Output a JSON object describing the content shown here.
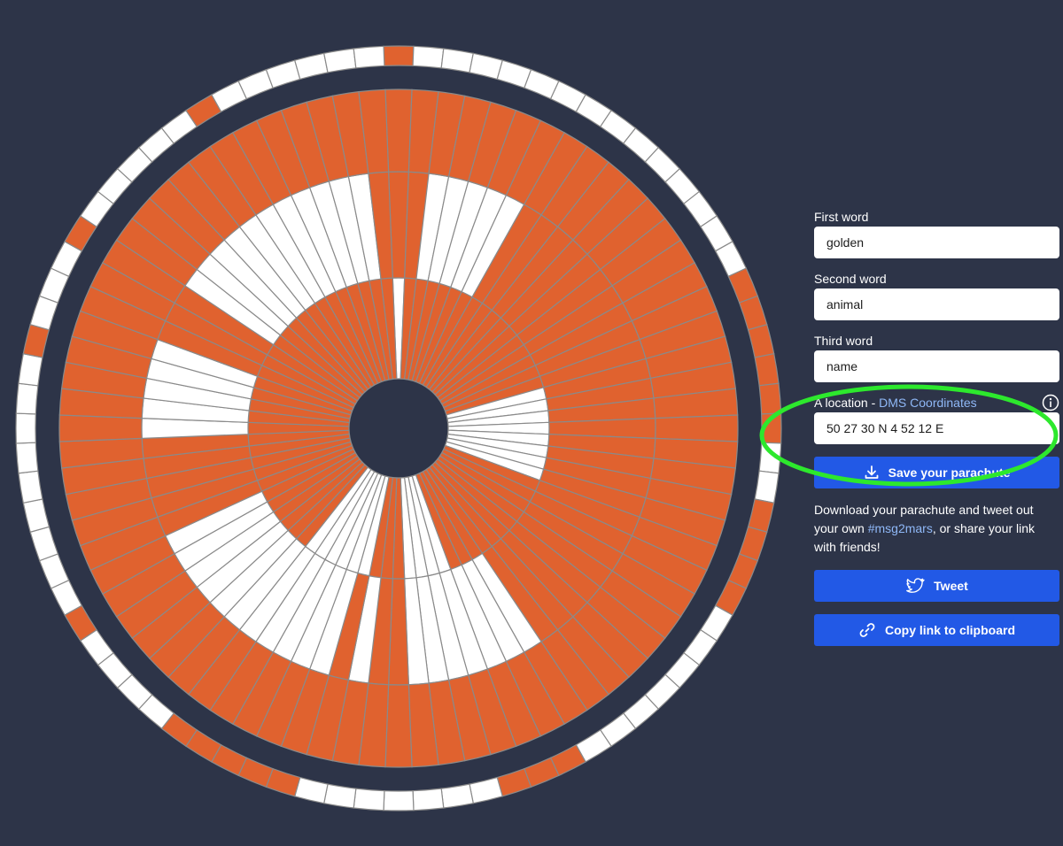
{
  "colors": {
    "background": "#2d3448",
    "orange": "#e0622f",
    "white": "#ffffff",
    "grid": "#8a8a8a",
    "button": "#2259e6",
    "link": "#8fb8f7",
    "highlight": "#2de82d"
  },
  "form": {
    "first_word": {
      "label": "First word",
      "value": "golden"
    },
    "second_word": {
      "label": "Second word",
      "value": "animal"
    },
    "third_word": {
      "label": "Third word",
      "value": "name"
    },
    "location": {
      "label": "A location - ",
      "link_label": "DMS Coordinates",
      "value": "50 27 30 N 4 52 12 E",
      "info_icon": "info-icon"
    }
  },
  "save_button": {
    "label": "Save your parachute",
    "icon": "download-icon"
  },
  "share": {
    "text_before": "Download your parachute and tweet out your own ",
    "hashtag": "#msg2mars",
    "text_after": ", or share your link with friends!"
  },
  "tweet_button": {
    "label": "Tweet",
    "icon": "twitter-icon"
  },
  "copy_button": {
    "label": "Copy link to clipboard",
    "icon": "link-icon"
  },
  "canopy": {
    "outer_ring_orange": [
      0,
      15,
      16,
      17,
      18,
      19,
      20,
      23,
      24,
      25,
      26,
      34,
      35,
      36,
      44,
      45,
      46,
      47,
      48,
      53,
      63,
      67,
      73
    ],
    "band_orange": {
      "outer": [
        0,
        1,
        2,
        3,
        4,
        5,
        6,
        7,
        8,
        9,
        10,
        11,
        12,
        13,
        14,
        15,
        16,
        17,
        18,
        19,
        20,
        21,
        22,
        23,
        24,
        25,
        26,
        27,
        28,
        29,
        30,
        31,
        32,
        33,
        34,
        35,
        36,
        37,
        38,
        39,
        40,
        41,
        42,
        43,
        44,
        45,
        46,
        47,
        48,
        49,
        50,
        51,
        52,
        53,
        54,
        55,
        56,
        57,
        58,
        59,
        60,
        61,
        62,
        63,
        64,
        65,
        66,
        67,
        68,
        69,
        70,
        71,
        72,
        73,
        74,
        75,
        76,
        77,
        78,
        79
      ],
      "middle": [
        0,
        1,
        7,
        8,
        9,
        10,
        11,
        12,
        13,
        14,
        15,
        16,
        17,
        18,
        19,
        20,
        21,
        22,
        23,
        24,
        25,
        26,
        27,
        28,
        29,
        30,
        31,
        32,
        40,
        41,
        43,
        55,
        56,
        57,
        58,
        59,
        65,
        66,
        67,
        79
      ],
      "inner": [
        1,
        2,
        3,
        4,
        5,
        6,
        7,
        8,
        9,
        10,
        11,
        12,
        13,
        14,
        15,
        16,
        25,
        26,
        27,
        28,
        29,
        30,
        31,
        32,
        33,
        34,
        35,
        40,
        41,
        42,
        49,
        50,
        51,
        52,
        53,
        54,
        55,
        56,
        57,
        58,
        59,
        60,
        61,
        62,
        63,
        64,
        65,
        66,
        67,
        68,
        69,
        70,
        71,
        72,
        73,
        74,
        75,
        76,
        77,
        78,
        79
      ]
    }
  }
}
